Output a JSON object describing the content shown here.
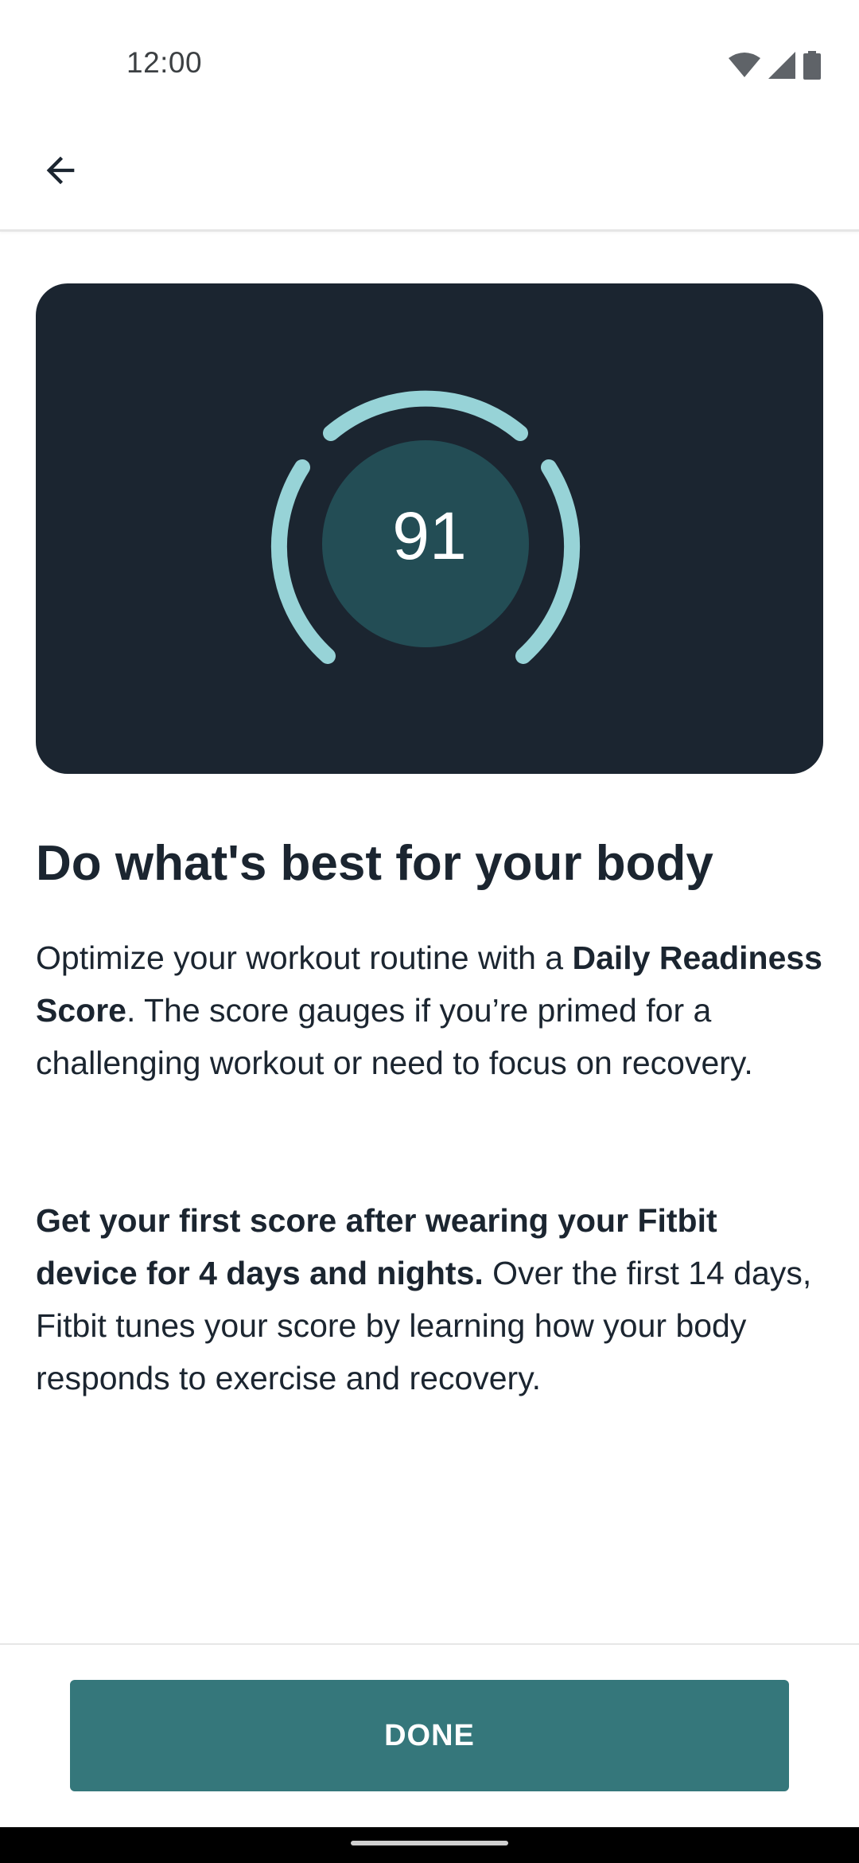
{
  "status_bar": {
    "time": "12:00",
    "icons": [
      "wifi-icon",
      "cellular-signal-icon",
      "battery-icon"
    ]
  },
  "app_bar": {
    "back_icon": "arrow-back-icon"
  },
  "hero": {
    "score": "91",
    "gauge_level": 0.91,
    "colors": {
      "card_background": "#1b2530",
      "gauge_arc": "#97d3d7",
      "score_circle": "#234d55"
    }
  },
  "content": {
    "headline": "Do what's best for your body",
    "paragraph1": {
      "text_a": "Optimize your workout routine with a ",
      "bold": "Daily Readiness Score",
      "text_b": ". The score gauges if you’re primed for a challenging workout or need to focus on recovery."
    },
    "paragraph2": {
      "bold": "Get your first score after wearing your Fitbit device for 4 days and nights.",
      "text": " Over the first 14 days, Fitbit tunes your score by learning how your body responds to exercise and recovery."
    }
  },
  "footer": {
    "done_label": "DONE",
    "accent_color": "#35777b"
  }
}
